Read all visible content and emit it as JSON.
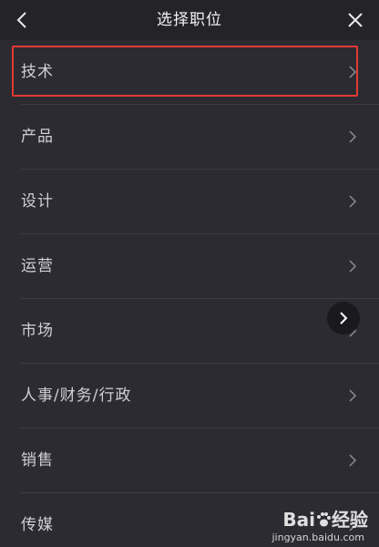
{
  "header": {
    "title": "选择职位",
    "back_icon": "chevron-left-icon",
    "close_icon": "close-icon"
  },
  "list": {
    "items": [
      {
        "label": "技术"
      },
      {
        "label": "产品"
      },
      {
        "label": "设计"
      },
      {
        "label": "运营"
      },
      {
        "label": "市场"
      },
      {
        "label": "人事/财务/行政"
      },
      {
        "label": "销售"
      },
      {
        "label": "传媒"
      }
    ]
  },
  "highlight": {
    "target": "技术",
    "color": "#e53935"
  },
  "floating_button": {
    "icon": "chevron-right-icon"
  },
  "watermark": {
    "logo_text": "Bai",
    "logo_suffix": "经验",
    "url": "jingyan.baidu.com"
  },
  "colors": {
    "background": "#2b2b31",
    "header": "#232328",
    "divider": "#3c3c43"
  }
}
